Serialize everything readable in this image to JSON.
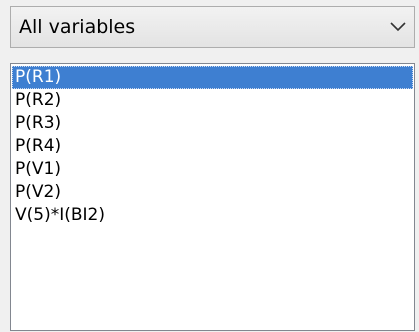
{
  "filter": {
    "selected_label": "All variables"
  },
  "variables": {
    "items": [
      {
        "label": "P(R1)",
        "selected": true
      },
      {
        "label": "P(R2)",
        "selected": false
      },
      {
        "label": "P(R3)",
        "selected": false
      },
      {
        "label": "P(R4)",
        "selected": false
      },
      {
        "label": "P(V1)",
        "selected": false
      },
      {
        "label": "P(V2)",
        "selected": false
      },
      {
        "label": "V(5)*I(BI2)",
        "selected": false
      }
    ]
  },
  "colors": {
    "selection": "#3e7fd1"
  },
  "icons": {
    "dropdown": "chevron-down-icon"
  }
}
